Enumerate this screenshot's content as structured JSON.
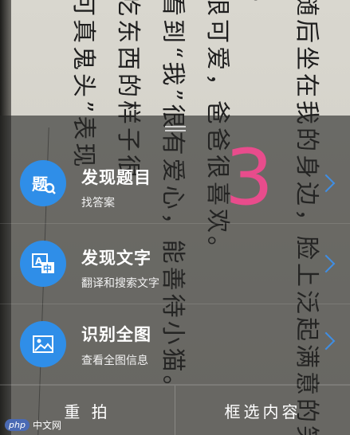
{
  "background_text": {
    "lines": [
      "随后坐在我的身边，脸上泛起满意的笑",
      "很可爱，爸爸很喜欢。",
      "看到“我”很有爱心，能善待小猫。",
      "吃东西的样子很",
      "可真鬼头”表现"
    ],
    "fragment": "。"
  },
  "countdown": "3",
  "options": [
    {
      "title": "发现题目",
      "subtitle": "找答案",
      "icon": "question-search-icon",
      "icon_glyph": "题"
    },
    {
      "title": "发现文字",
      "subtitle": "翻译和搜索文字",
      "icon": "translate-icon",
      "icon_glyph": "A中"
    },
    {
      "title": "识别全图",
      "subtitle": "查看全图信息",
      "icon": "image-recognize-icon",
      "icon_glyph": "▣"
    }
  ],
  "bottom_bar": {
    "retake_label": "重 拍",
    "select_label": "框选内容"
  },
  "watermark": {
    "badge": "php",
    "text": "中文网"
  },
  "colors": {
    "accent": "#2f8ee8",
    "countdown": "#e84c8c",
    "sheet": "rgba(40,40,38,0.62)"
  }
}
